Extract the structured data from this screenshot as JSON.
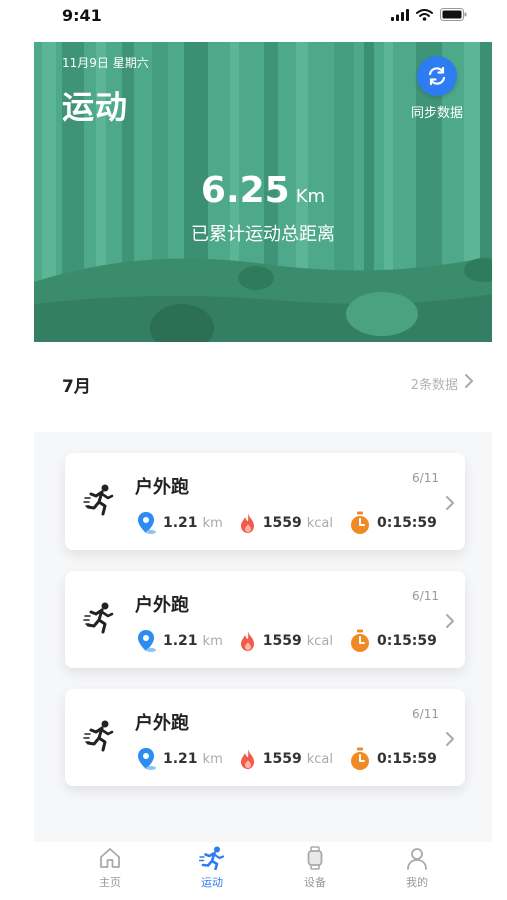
{
  "status_bar": {
    "time": "9:41"
  },
  "hero": {
    "date": "11月9日  星期六",
    "title": "运动",
    "sync_label": "同步数据",
    "distance_value": "6.25",
    "distance_unit": "Km",
    "distance_caption": "已累计运动总距离"
  },
  "month": {
    "label": "7月",
    "count": "2条数据"
  },
  "records": [
    {
      "title": "户外跑",
      "date": "6/11",
      "distance": "1.21",
      "distance_unit": "km",
      "calories": "1559",
      "calories_unit": "kcal",
      "duration": "0:15:59"
    },
    {
      "title": "户外跑",
      "date": "6/11",
      "distance": "1.21",
      "distance_unit": "km",
      "calories": "1559",
      "calories_unit": "kcal",
      "duration": "0:15:59"
    },
    {
      "title": "户外跑",
      "date": "6/11",
      "distance": "1.21",
      "distance_unit": "km",
      "calories": "1559",
      "calories_unit": "kcal",
      "duration": "0:15:59"
    }
  ],
  "tabs": [
    {
      "label": "主页",
      "icon": "home-icon"
    },
    {
      "label": "运动",
      "icon": "running-icon",
      "active": true
    },
    {
      "label": "设备",
      "icon": "watch-icon"
    },
    {
      "label": "我的",
      "icon": "user-icon"
    }
  ],
  "colors": {
    "accent": "#2d7cf2",
    "hero_green": "#4ea98a",
    "location_blue": "#2d8cf0",
    "flame_red": "#f25a4a",
    "timer_orange": "#f08a24"
  }
}
